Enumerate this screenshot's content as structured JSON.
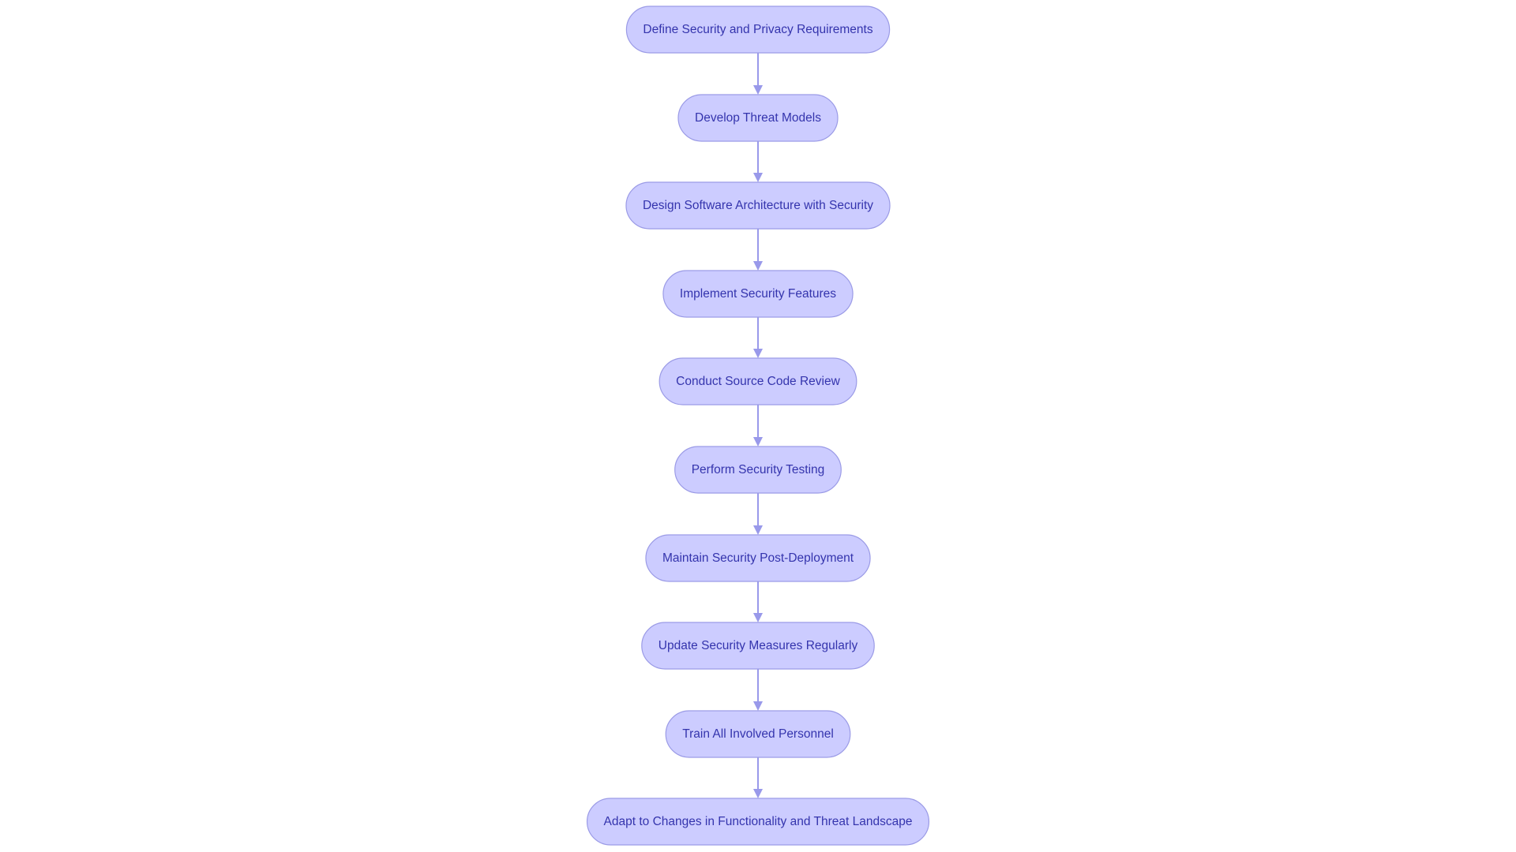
{
  "diagram": {
    "type": "flowchart",
    "direction": "top-to-bottom",
    "colors": {
      "node_fill": "#ccccff",
      "node_stroke": "#9b9be6",
      "node_text": "#3434ad",
      "edge": "#9999ea",
      "background": "#ffffff"
    },
    "nodes": [
      {
        "id": "n1",
        "label": "Define Security and Privacy Requirements"
      },
      {
        "id": "n2",
        "label": "Develop Threat Models"
      },
      {
        "id": "n3",
        "label": "Design Software Architecture with Security"
      },
      {
        "id": "n4",
        "label": "Implement Security Features"
      },
      {
        "id": "n5",
        "label": "Conduct Source Code Review"
      },
      {
        "id": "n6",
        "label": "Perform Security Testing"
      },
      {
        "id": "n7",
        "label": "Maintain Security Post-Deployment"
      },
      {
        "id": "n8",
        "label": "Update Security Measures Regularly"
      },
      {
        "id": "n9",
        "label": "Train All Involved Personnel"
      },
      {
        "id": "n10",
        "label": "Adapt to Changes in Functionality and Threat Landscape"
      }
    ],
    "edges": [
      {
        "from": "n1",
        "to": "n2"
      },
      {
        "from": "n2",
        "to": "n3"
      },
      {
        "from": "n3",
        "to": "n4"
      },
      {
        "from": "n4",
        "to": "n5"
      },
      {
        "from": "n5",
        "to": "n6"
      },
      {
        "from": "n6",
        "to": "n7"
      },
      {
        "from": "n7",
        "to": "n8"
      },
      {
        "from": "n8",
        "to": "n9"
      },
      {
        "from": "n9",
        "to": "n10"
      }
    ]
  }
}
